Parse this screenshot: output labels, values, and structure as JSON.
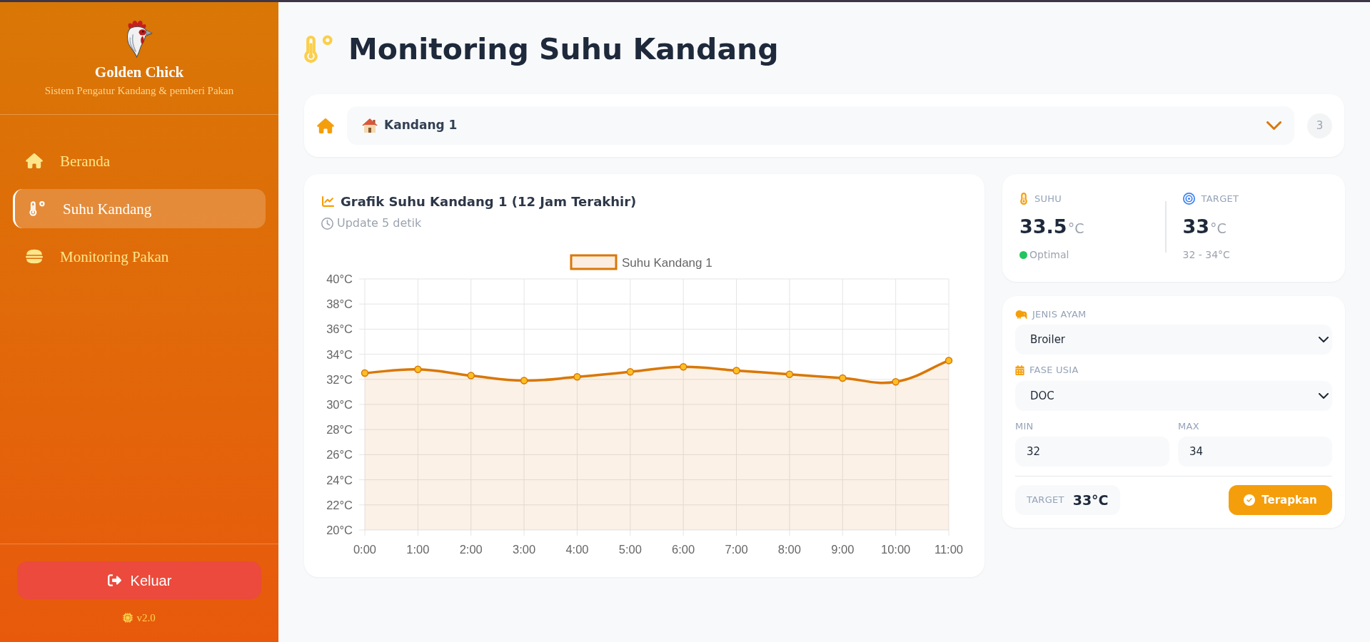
{
  "sidebar": {
    "brand": "Golden Chick",
    "tagline": "Sistem Pengatur Kandang & pemberi Pakan",
    "items": [
      {
        "label": "Beranda",
        "kind": "home",
        "selected": false
      },
      {
        "label": "Suhu Kandang",
        "kind": "temperature",
        "selected": true
      },
      {
        "label": "Monitoring Pakan",
        "kind": "feed",
        "selected": false
      }
    ],
    "logout_button": "Keluar",
    "version": "v2.0"
  },
  "header": {
    "title": "Monitoring Suhu Kandang"
  },
  "coop_selector": {
    "value": "Kandang 1",
    "count": "3"
  },
  "chart_card": {
    "title": "Grafik Suhu Kandang 1 (12 Jam Terakhir)",
    "update_note": "Update 5 detik",
    "chart_data": {
      "type": "area",
      "categories": [
        "0:00",
        "1:00",
        "2:00",
        "3:00",
        "4:00",
        "5:00",
        "6:00",
        "7:00",
        "8:00",
        "9:00",
        "10:00",
        "11:00"
      ],
      "series": [
        {
          "name": "Suhu Kandang 1",
          "color": "#d97706",
          "values": [
            32.5,
            32.8,
            32.3,
            31.9,
            32.2,
            32.6,
            33.0,
            32.7,
            32.4,
            32.1,
            31.8,
            33.5
          ]
        }
      ],
      "ylim": [
        20,
        40
      ],
      "yticks": [
        {
          "value": 20,
          "label": "20°C"
        },
        {
          "value": 22,
          "label": "22°C"
        },
        {
          "value": 24,
          "label": "24°C"
        },
        {
          "value": 26,
          "label": "26°C"
        },
        {
          "value": 28,
          "label": "28°C"
        },
        {
          "value": 30,
          "label": "30°C"
        },
        {
          "value": 32,
          "label": "32°C"
        },
        {
          "value": 34,
          "label": "34°C"
        },
        {
          "value": 36,
          "label": "36°C"
        },
        {
          "value": 38,
          "label": "38°C"
        },
        {
          "value": 40,
          "label": "40°C"
        }
      ],
      "grid": true
    }
  },
  "readings": [
    {
      "kind": "temperature",
      "label": "SUHU",
      "value": "33.5",
      "unit": "°C",
      "status": {
        "label": "Optimal",
        "color": "#22c55e"
      }
    },
    {
      "kind": "target",
      "label": "TARGET",
      "value": "33",
      "unit": "°C",
      "range": "32 - 34°C"
    }
  ],
  "settings": {
    "selects": [
      {
        "label": "JENIS AYAM",
        "value": "Broiler"
      },
      {
        "label": "FASE USIA",
        "value": "DOC"
      }
    ],
    "limits": [
      {
        "label": "MIN",
        "value": "32"
      },
      {
        "label": "MAX",
        "value": "34"
      }
    ],
    "target": {
      "label": "TARGET",
      "value": "33°C"
    },
    "apply_button": "Terapkan"
  }
}
